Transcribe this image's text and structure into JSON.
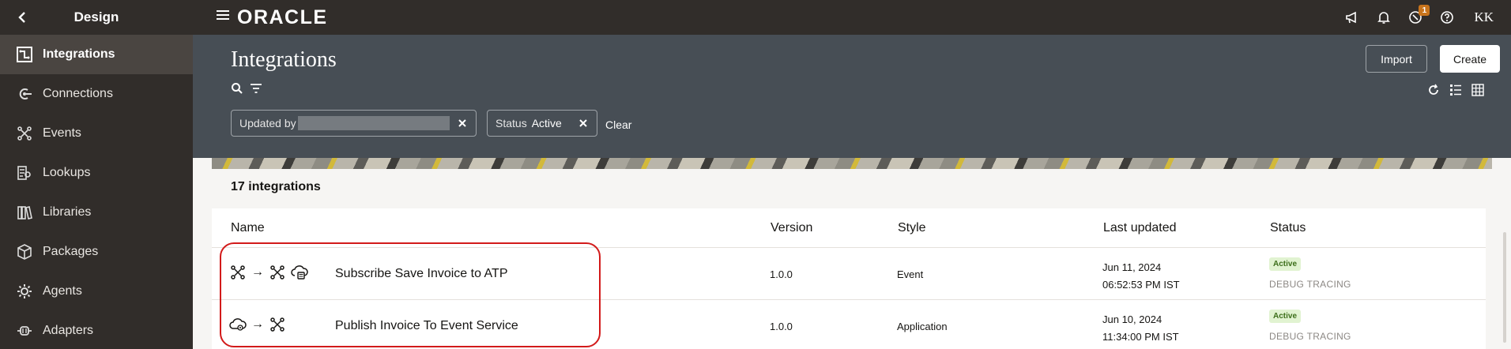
{
  "sidebar": {
    "title": "Design",
    "items": [
      {
        "label": "Integrations",
        "icon": "integrations-icon",
        "active": true
      },
      {
        "label": "Connections",
        "icon": "connections-icon"
      },
      {
        "label": "Events",
        "icon": "events-icon"
      },
      {
        "label": "Lookups",
        "icon": "lookups-icon"
      },
      {
        "label": "Libraries",
        "icon": "libraries-icon"
      },
      {
        "label": "Packages",
        "icon": "packages-icon"
      },
      {
        "label": "Agents",
        "icon": "agents-icon"
      },
      {
        "label": "Adapters",
        "icon": "adapters-icon"
      }
    ]
  },
  "topbar": {
    "brand": "ORACLE",
    "notification_badge": "1",
    "avatar": "KK"
  },
  "header": {
    "title": "Integrations",
    "import_label": "Import",
    "create_label": "Create",
    "filters": {
      "updated_by_label": "Updated by",
      "status_label": "Status",
      "status_value": "Active",
      "clear_label": "Clear"
    }
  },
  "list": {
    "count": "17 integrations",
    "columns": {
      "name": "Name",
      "version": "Version",
      "style": "Style",
      "last_updated": "Last updated",
      "status": "Status"
    },
    "rows": [
      {
        "name": "Subscribe Save Invoice to ATP",
        "version": "1.0.0",
        "style": "Event",
        "date": "Jun 11, 2024",
        "time": "06:52:53 PM IST",
        "status": "Active",
        "substatus": "DEBUG TRACING",
        "arrow": "→"
      },
      {
        "name": "Publish Invoice To Event Service",
        "version": "1.0.0",
        "style": "Application",
        "date": "Jun 10, 2024",
        "time": "11:34:00 PM IST",
        "status": "Active",
        "substatus": "DEBUG TRACING",
        "arrow": "→"
      }
    ]
  },
  "colors": {
    "topbar": "#312d2a",
    "band": "#474e55",
    "active_badge_bg": "#e1f3d1",
    "highlight": "#d21a1a"
  }
}
